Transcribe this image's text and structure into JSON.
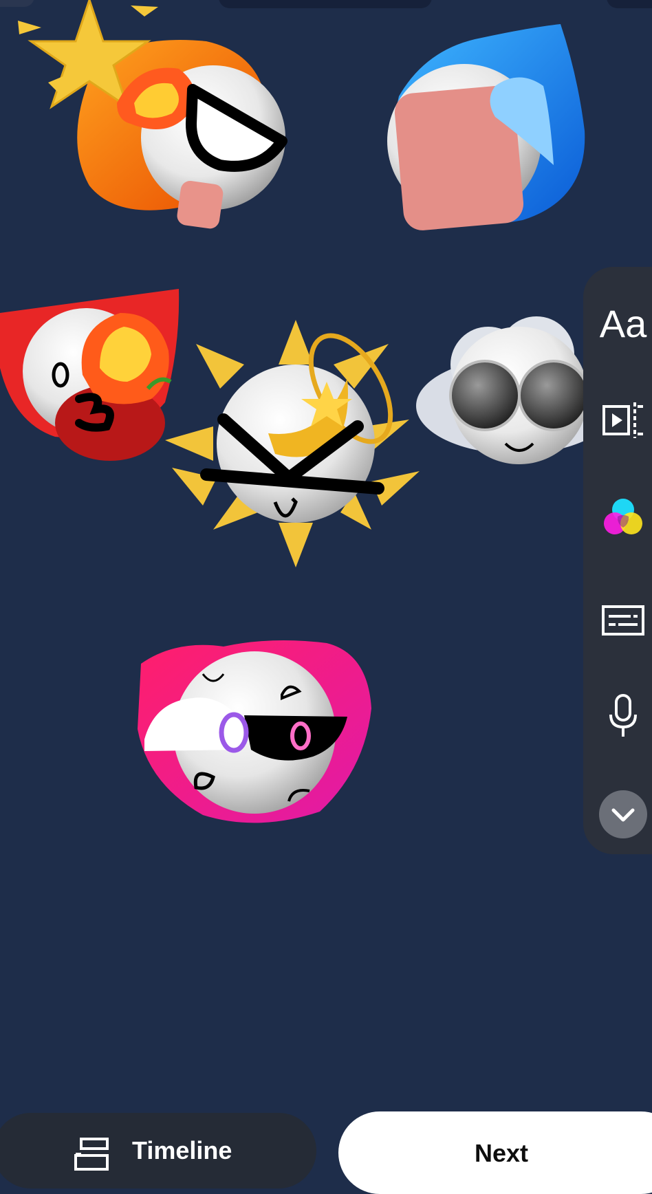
{
  "toolbar": {
    "text_label": "Aa",
    "tools": [
      "text-tool",
      "clip-tool",
      "color-tool",
      "captions-tool",
      "voice-tool",
      "collapse-tool"
    ]
  },
  "bottom_bar": {
    "timeline_label": "Timeline",
    "next_label": "Next"
  },
  "stickers": [
    "star-fire-emoji",
    "water-drop-emoji",
    "red-fire-emoji",
    "sun-star-emoji",
    "cloud-glasses-emoji",
    "pink-heart-emoji"
  ],
  "colors": {
    "background": "#1e2d4a",
    "rail": "#2b303b",
    "next_button": "#ffffff"
  }
}
